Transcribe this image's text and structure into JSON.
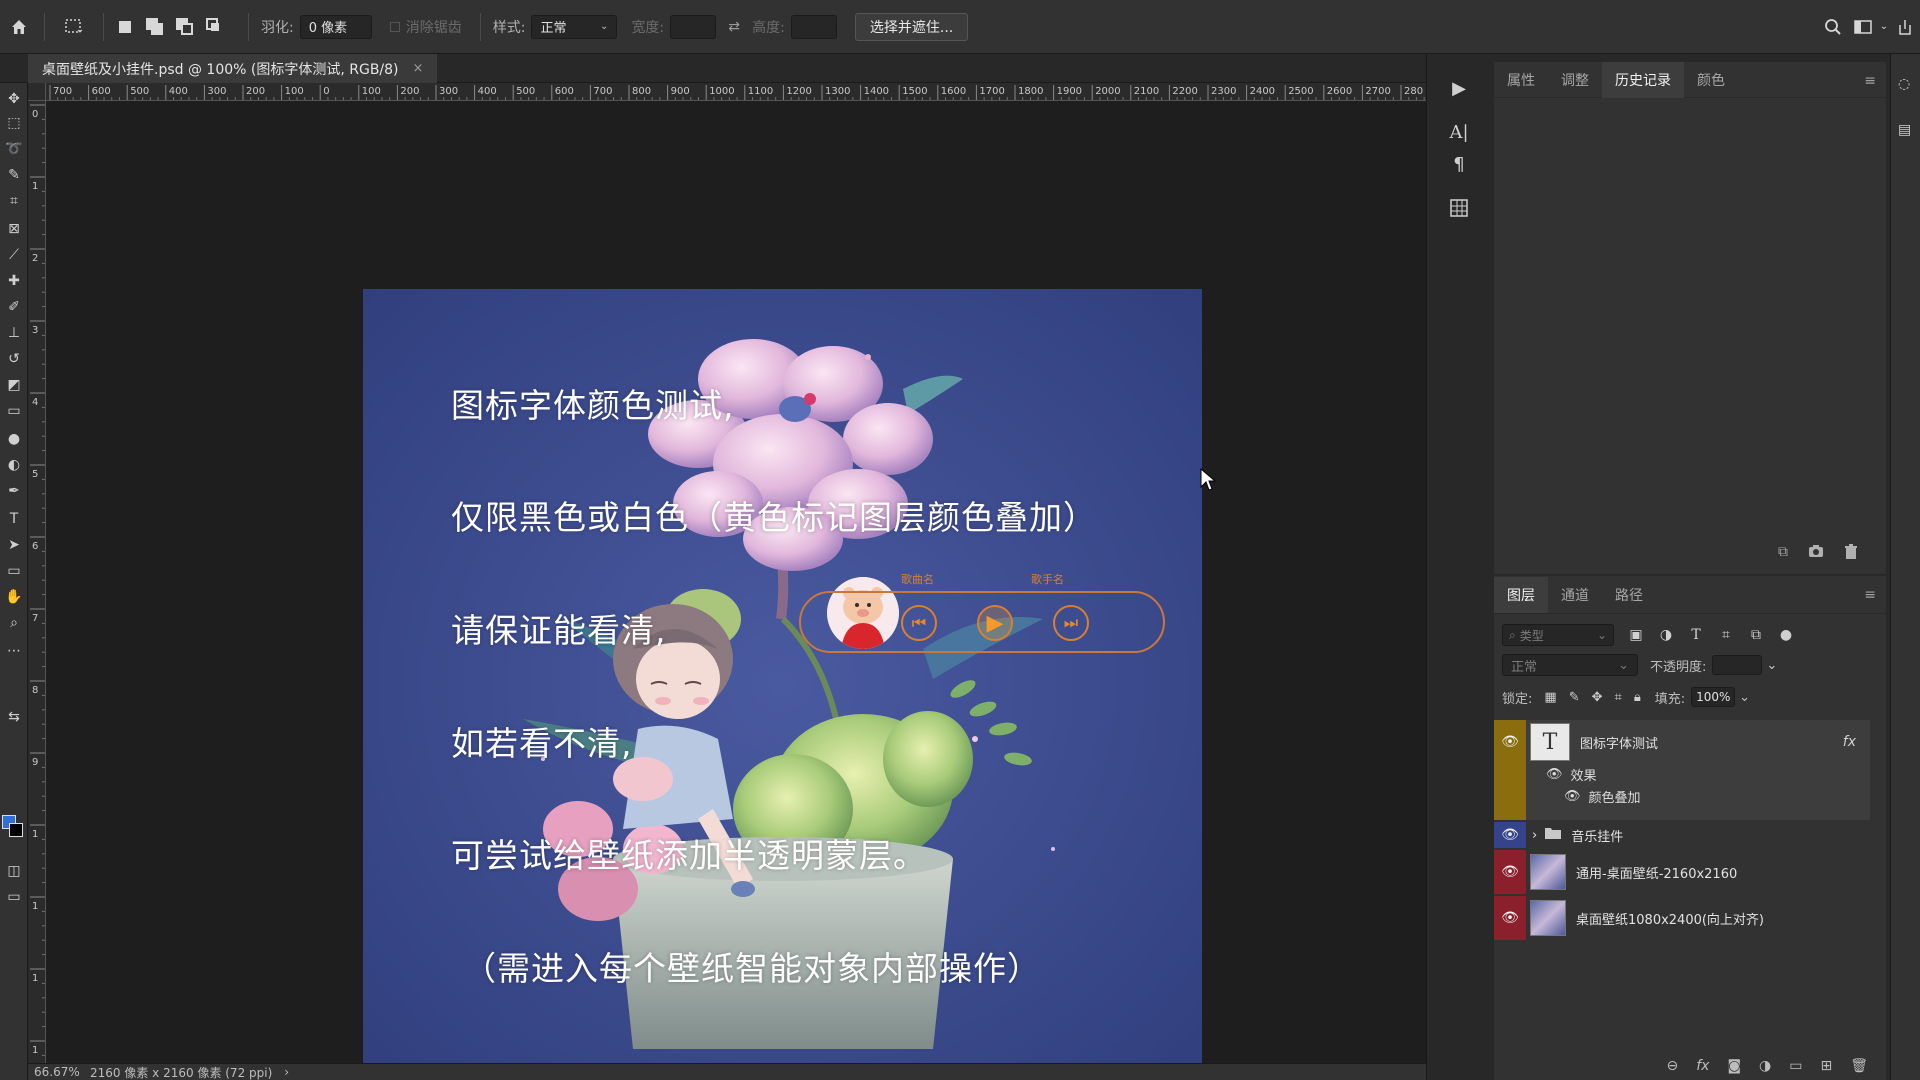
{
  "options_bar": {
    "feather_label": "羽化:",
    "feather_value": "0 像素",
    "antialias_label": "消除锯齿",
    "style_label": "样式:",
    "style_value": "正常",
    "width_label": "宽度:",
    "height_label": "高度:",
    "select_mask_button": "选择并遮住..."
  },
  "document": {
    "tab_title": "桌面壁纸及小挂件.psd @ 100% (图标字体测试, RGB/8)",
    "close": "×"
  },
  "ruler": {
    "h_labels": [
      "700",
      "600",
      "500",
      "400",
      "300",
      "200",
      "100",
      "0",
      "100",
      "200",
      "300",
      "400",
      "500",
      "600",
      "700",
      "800",
      "900",
      "1000",
      "1100",
      "1200",
      "1300",
      "1400",
      "1500",
      "1600",
      "1700",
      "1800",
      "1900",
      "2000",
      "2100",
      "2200",
      "2300",
      "2400",
      "2500",
      "2600",
      "2700",
      "280"
    ],
    "v_labels": [
      "0",
      "1",
      "2",
      "3",
      "4",
      "5",
      "6",
      "7",
      "8",
      "9",
      "1",
      "1",
      "1",
      "1"
    ]
  },
  "canvas": {
    "lines": [
      "图标字体颜色测试,",
      "仅限黑色或白色（黄色标记图层颜色叠加）",
      "请保证能看清,",
      "如若看不清,",
      "可尝试给壁纸添加半透明蒙层。",
      "（需进入每个壁纸智能对象内部操作）"
    ],
    "player_label_left": "歌曲名",
    "player_label_right": "歌手名"
  },
  "status": {
    "zoom": "66.67%",
    "doc_info": "2160 像素 x 2160 像素 (72 ppi)"
  },
  "top_panel": {
    "tabs": [
      "属性",
      "调整",
      "历史记录",
      "颜色"
    ],
    "active_tab": "历史记录"
  },
  "layers_panel": {
    "tabs": [
      "图层",
      "通道",
      "路径"
    ],
    "kind_placeholder": "类型",
    "blend_mode": "正常",
    "opacity_label": "不透明度:",
    "lock_label": "锁定:",
    "fill_label": "填充:",
    "fill_value": "100%",
    "layers": [
      {
        "name": "图标字体测试",
        "color": "#8a6e0e",
        "type": "text",
        "fx": "fx"
      },
      {
        "name": "音乐挂件",
        "color": "#34438a",
        "type": "group"
      },
      {
        "name": "通用-桌面壁纸-2160x2160",
        "color": "#8c1f2c",
        "type": "smart"
      },
      {
        "name": "桌面壁纸1080x2400(向上对齐)",
        "color": "#8c1f2c",
        "type": "smart"
      }
    ],
    "effects_label": "效果",
    "effect_item": "颜色叠加"
  },
  "icons": {
    "home": "home-icon",
    "search": "search-icon",
    "eye": "eye-icon",
    "folder": "folder-icon",
    "menu": "menu-icon"
  }
}
